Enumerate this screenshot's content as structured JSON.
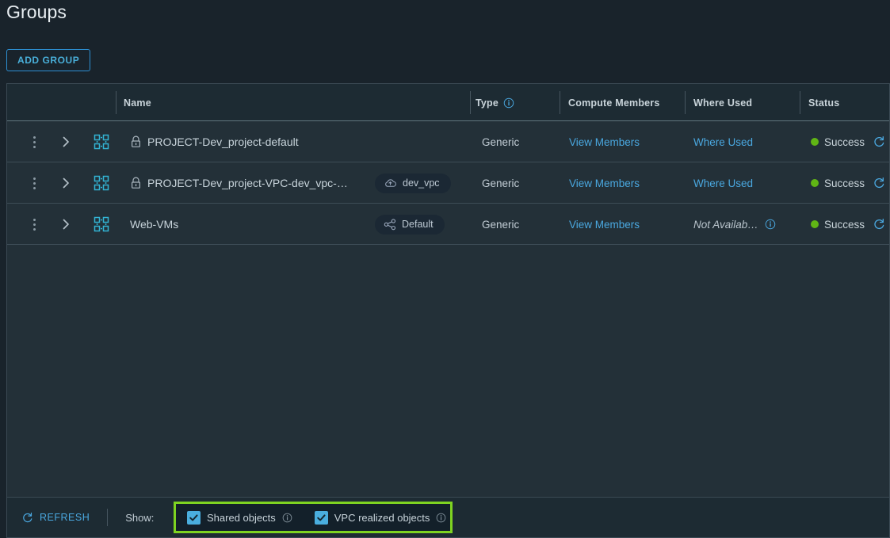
{
  "header": {
    "title": "Groups",
    "add_group_label": "ADD GROUP"
  },
  "table": {
    "columns": [
      {
        "key": "menu",
        "label": ""
      },
      {
        "key": "expand",
        "label": ""
      },
      {
        "key": "name",
        "label": "Name"
      },
      {
        "key": "type",
        "label": "Type",
        "info_icon": "info-icon"
      },
      {
        "key": "compute",
        "label": "Compute Members"
      },
      {
        "key": "where",
        "label": "Where Used"
      },
      {
        "key": "status",
        "label": "Status"
      }
    ],
    "rows": [
      {
        "menu_icon": "kebab-menu-icon",
        "expand_icon": "chevron-right-icon",
        "group_icon": "group-objects-icon",
        "lock_icon": "lock-icon",
        "locked": true,
        "name": "PROJECT-Dev_project-default",
        "badge": null,
        "badge_icon": null,
        "type": "Generic",
        "compute_members": "View Members",
        "where_used": "Where Used",
        "where_used_link": true,
        "where_used_info": false,
        "status": "Success",
        "status_color": "#60b515",
        "status_refresh_icon": "refresh-icon"
      },
      {
        "menu_icon": "kebab-menu-icon",
        "expand_icon": "chevron-right-icon",
        "group_icon": "group-objects-icon",
        "lock_icon": "lock-icon",
        "locked": true,
        "name": "PROJECT-Dev_project-VPC-dev_vpc-…",
        "badge": "dev_vpc",
        "badge_icon": "vpc-cloud-icon",
        "type": "Generic",
        "compute_members": "View Members",
        "where_used": "Where Used",
        "where_used_link": true,
        "where_used_info": false,
        "status": "Success",
        "status_color": "#60b515",
        "status_refresh_icon": "refresh-icon"
      },
      {
        "menu_icon": "kebab-menu-icon",
        "expand_icon": "chevron-right-icon",
        "group_icon": "group-objects-icon",
        "lock_icon": null,
        "locked": false,
        "name": "Web-VMs",
        "badge": "Default",
        "badge_icon": "share-nodes-icon",
        "type": "Generic",
        "compute_members": "View Members",
        "where_used": "Not Availab…",
        "where_used_link": false,
        "where_used_info": true,
        "status": "Success",
        "status_color": "#60b515",
        "status_refresh_icon": "refresh-icon"
      }
    ]
  },
  "footer": {
    "refresh_label": "REFRESH",
    "refresh_icon": "refresh-icon",
    "show_label": "Show:",
    "checkboxes": [
      {
        "label": "Shared objects",
        "checked": true,
        "info_icon": "info-icon"
      },
      {
        "label": "VPC realized objects",
        "checked": true,
        "info_icon": "info-icon"
      }
    ],
    "highlight_color": "#7ed321"
  }
}
